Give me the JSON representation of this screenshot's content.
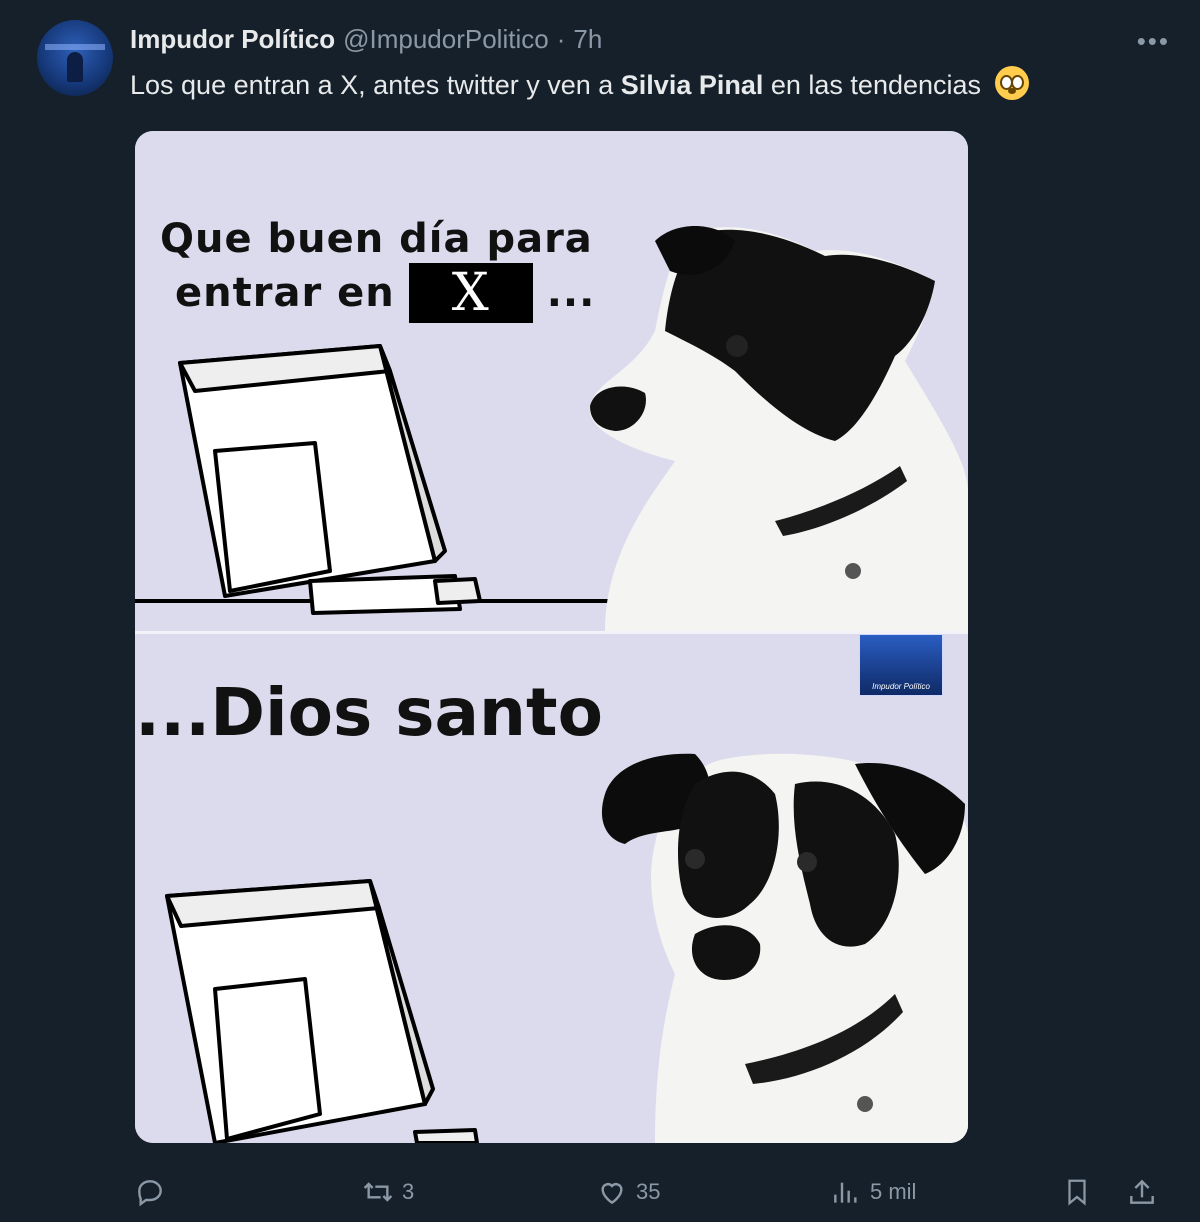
{
  "tweet": {
    "author_name": "Impudor Político",
    "author_handle": "@ImpudorPolitico",
    "separator": "·",
    "time": "7h",
    "avatar_caption": "Impudor Político",
    "text_before": "Los que entran a X, antes twitter y ven a ",
    "text_bold": "Silvia Pinal",
    "text_after": " en las tendencias",
    "emoji": "flushed-face"
  },
  "meme": {
    "top_line1": "Que buen día para",
    "top_line2": "entrar en",
    "x_logo": "X",
    "top_line2_suffix": "...",
    "bottom_text": "...Dios santo",
    "watermark_caption": "Impudor Político"
  },
  "actions": {
    "reply_count": "",
    "retweet_count": "3",
    "like_count": "35",
    "views_count": "5 mil"
  },
  "colors": {
    "background": "#15202b",
    "text_primary": "#e7e9ea",
    "text_secondary": "#8b98a5",
    "meme_background": "#dcdbed"
  }
}
